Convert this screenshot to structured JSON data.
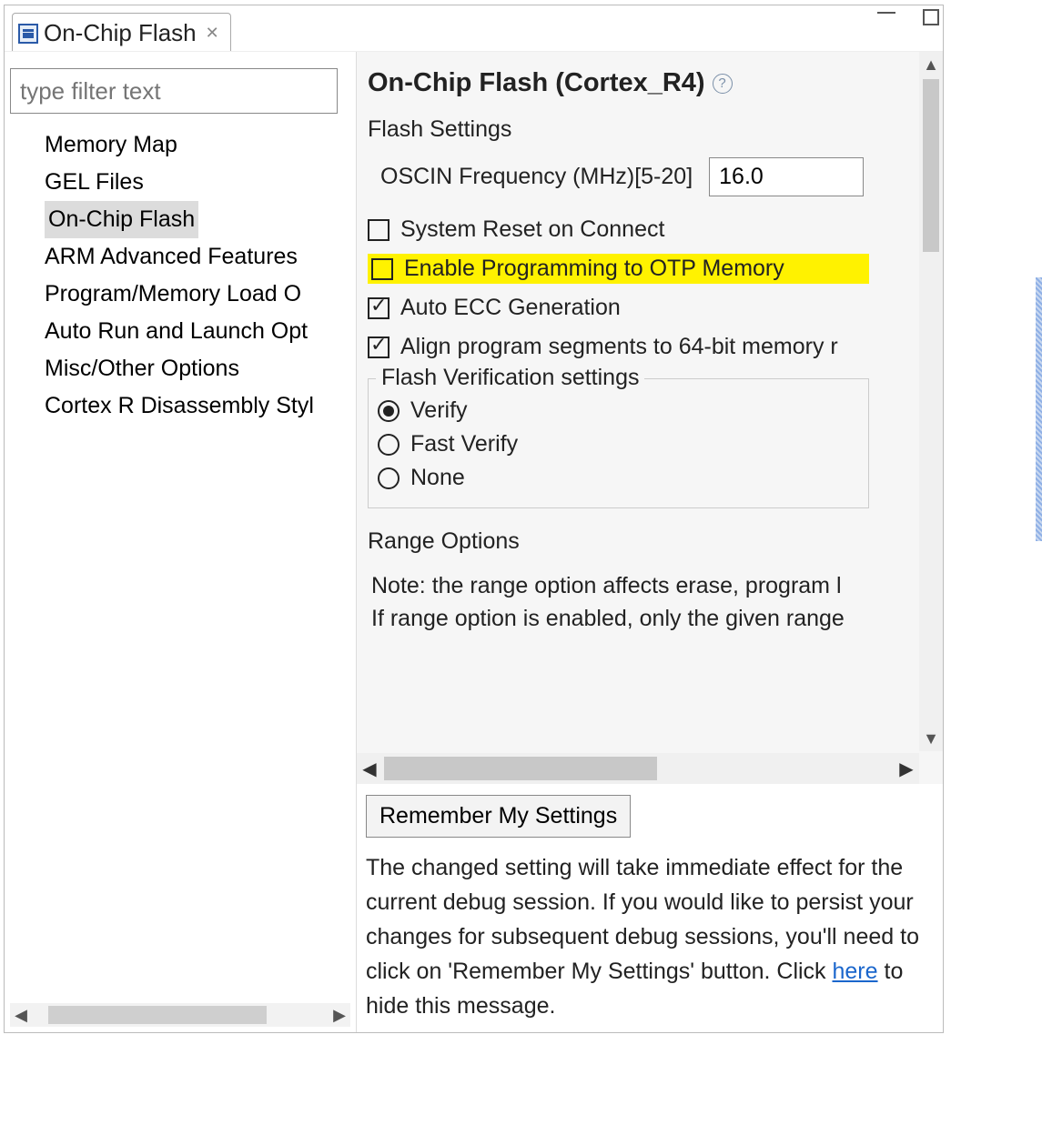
{
  "tab": {
    "title": "On-Chip Flash"
  },
  "filter": {
    "placeholder": "type filter text"
  },
  "tree": {
    "items": [
      "Memory Map",
      "GEL Files",
      "On-Chip Flash",
      "ARM Advanced Features",
      "Program/Memory Load O",
      "Auto Run and Launch Opt",
      "Misc/Other Options",
      "Cortex R Disassembly Styl"
    ],
    "selected_index": 2
  },
  "content": {
    "title": "On-Chip Flash (Cortex_R4)",
    "section_flash_settings": "Flash Settings",
    "oscin_label": "OSCIN Frequency (MHz)[5-20]",
    "oscin_value": "16.0",
    "cb_system_reset": "System Reset on Connect",
    "cb_enable_otp": "Enable Programming to OTP Memory",
    "cb_auto_ecc": "Auto ECC Generation",
    "cb_align64": "Align program segments to 64-bit memory r",
    "verification_legend": "Flash Verification settings",
    "radio_verify": "Verify",
    "radio_fast": "Fast Verify",
    "radio_none": "None",
    "section_range": "Range Options",
    "range_note_l1": "Note: the range option affects erase, program l",
    "range_note_l2": "If range option is enabled, only the given range"
  },
  "footer": {
    "remember_btn": "Remember My Settings",
    "text_before_link": "The changed setting will take immediate effect for the current debug session.  If you would like to persist your changes for subsequent debug sessions, you'll need to click on 'Remember My Settings' button. Click ",
    "link_text": "here",
    "text_after_link": " to hide this message."
  }
}
